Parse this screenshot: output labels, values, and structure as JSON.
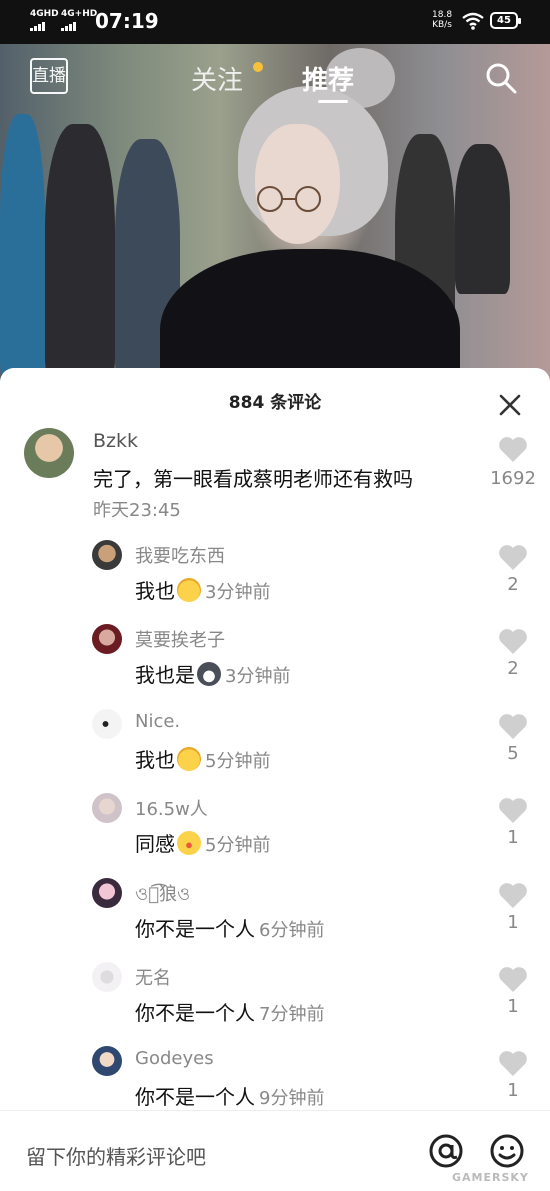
{
  "status_bar": {
    "signal1_label": "4GHD",
    "signal2_label": "4G+HD",
    "time": "07:19",
    "speed_value": "18.8",
    "speed_unit": "KB/s",
    "battery": "45"
  },
  "top_nav": {
    "live_label": "直播",
    "tabs": [
      {
        "label": "关注"
      },
      {
        "label": "推荐"
      }
    ],
    "active_tab": "推荐",
    "dot_color": "#f6c23b"
  },
  "comments_panel": {
    "title": "884 条评论",
    "main_comment": {
      "user": "Bzkk",
      "text": "完了，第一眼看成蔡明老师还有救吗",
      "time": "昨天23:45",
      "likes": "1692"
    },
    "replies": [
      {
        "user": "我要吃东西",
        "text": "我也",
        "emoji": "laugh-cry-emoji",
        "time": "3分钟前",
        "likes": "2"
      },
      {
        "user": "莫要挨老子",
        "text": "我也是",
        "emoji": "husky-emoji",
        "time": "3分钟前",
        "likes": "2"
      },
      {
        "user": "Nice.",
        "text": "我也",
        "emoji": "laugh-cry-emoji",
        "time": "5分钟前",
        "likes": "5"
      },
      {
        "user": "16.5w人",
        "text": "同感",
        "emoji": "surprised-emoji",
        "time": "5分钟前",
        "likes": "1"
      },
      {
        "user": "ও独͡狼ও",
        "text": "你不是一个人",
        "emoji": "",
        "time": "6分钟前",
        "likes": "1"
      },
      {
        "user": "无名",
        "text": "你不是一个人",
        "emoji": "",
        "time": "7分钟前",
        "likes": "1"
      },
      {
        "user": "Godeyes",
        "text": "你不是一个人",
        "emoji": "",
        "time": "9分钟前",
        "likes": "1"
      }
    ]
  },
  "input_bar": {
    "placeholder": "留下你的精彩评论吧",
    "at_icon": "at-icon",
    "emoji_icon": "smile-icon"
  },
  "watermark": "GAMERSKY",
  "colors": {
    "heart": "#cfcfcf",
    "muted_text": "#888888"
  }
}
